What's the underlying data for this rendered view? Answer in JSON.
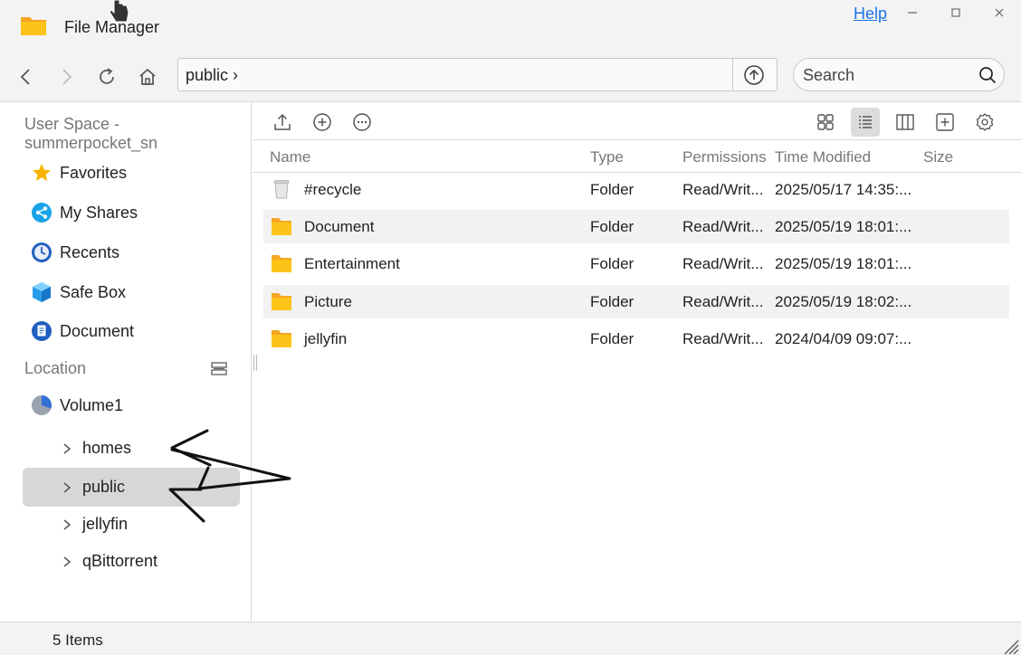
{
  "window": {
    "title": "File Manager",
    "help_label": "Help",
    "controls": [
      "minimize-icon",
      "maximize-icon",
      "close-icon"
    ]
  },
  "toolbar": {
    "path": "public",
    "search_placeholder": "Search"
  },
  "sidebar": {
    "user_space": "User Space - summerpocket_sn",
    "items": [
      {
        "label": "Favorites",
        "icon": "star-icon"
      },
      {
        "label": "My Shares",
        "icon": "share-icon"
      },
      {
        "label": "Recents",
        "icon": "clock-icon"
      },
      {
        "label": "Safe Box",
        "icon": "safe-box-icon"
      },
      {
        "label": "Document",
        "icon": "document-icon"
      }
    ],
    "location_label": "Location",
    "volume": "Volume1",
    "tree": [
      {
        "label": "homes",
        "selected": false
      },
      {
        "label": "public",
        "selected": true
      },
      {
        "label": "jellyfin",
        "selected": false
      },
      {
        "label": "qBittorrent",
        "selected": false
      }
    ]
  },
  "columns": {
    "name": "Name",
    "type": "Type",
    "permissions": "Permissions",
    "time_modified": "Time Modified",
    "size": "Size"
  },
  "files": [
    {
      "name": "#recycle",
      "type": "Folder",
      "permissions": "Read/Writ...",
      "time": "2025/05/17 14:35:...",
      "icon": "recycle-bin-icon"
    },
    {
      "name": "Document",
      "type": "Folder",
      "permissions": "Read/Writ...",
      "time": "2025/05/19 18:01:...",
      "icon": "folder-icon"
    },
    {
      "name": "Entertainment",
      "type": "Folder",
      "permissions": "Read/Writ...",
      "time": "2025/05/19 18:01:...",
      "icon": "folder-icon"
    },
    {
      "name": "Picture",
      "type": "Folder",
      "permissions": "Read/Writ...",
      "time": "2025/05/19 18:02:...",
      "icon": "folder-icon"
    },
    {
      "name": "jellyfin",
      "type": "Folder",
      "permissions": "Read/Writ...",
      "time": "2024/04/09 09:07:...",
      "icon": "folder-icon"
    }
  ],
  "status": {
    "item_count": "5 Items"
  },
  "colors": {
    "folder": "#f9c623",
    "accent_link": "#1a73e8",
    "selected_bg": "#d7d7d7"
  }
}
